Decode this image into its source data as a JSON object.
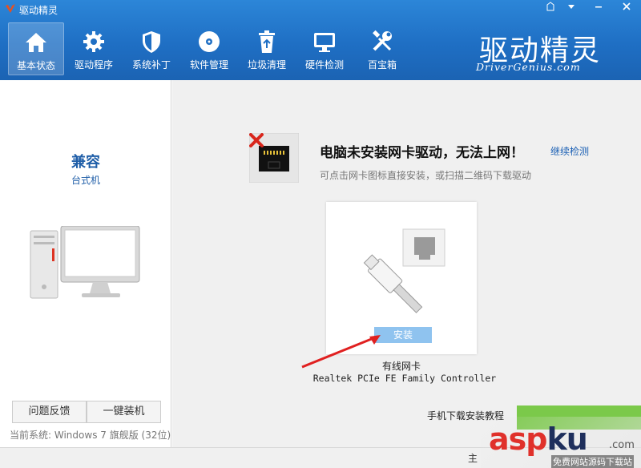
{
  "window": {
    "title": "驱动精灵",
    "controls": [
      "skin",
      "menu",
      "minimize",
      "close"
    ]
  },
  "nav": [
    {
      "label": "基本状态",
      "icon": "home-icon",
      "active": true
    },
    {
      "label": "驱动程序",
      "icon": "gear-icon",
      "active": false
    },
    {
      "label": "系统补丁",
      "icon": "shield-icon",
      "active": false
    },
    {
      "label": "软件管理",
      "icon": "disc-icon",
      "active": false
    },
    {
      "label": "垃圾清理",
      "icon": "recycle-bin-icon",
      "active": false
    },
    {
      "label": "硬件检测",
      "icon": "monitor-icon",
      "active": false
    },
    {
      "label": "百宝箱",
      "icon": "tools-icon",
      "active": false
    }
  ],
  "brand": {
    "cn": "驱动精灵",
    "url": "DriverGenius.com"
  },
  "left": {
    "title": "兼容",
    "subtitle": "台式机",
    "feedback_label": "问题反馈",
    "install_label": "一键装机",
    "system_prefix": "当前系统:",
    "system_value": "Windows 7 旗舰版 (32位)"
  },
  "main": {
    "alert_title": "电脑未安装网卡驱动，无法上网！",
    "recheck_label": "继续检测",
    "alert_desc": "可点击网卡图标直接安装，或扫描二维码下载驱动",
    "card_install_label": "安装",
    "device_name": "有线网卡",
    "device_model": "Realtek PCIe FE Family Controller",
    "mobile_tutorial": "手机下载安装教程"
  },
  "statusbar": {
    "main_label": "主"
  },
  "watermark": {
    "red": "asp",
    "dark": "ku",
    "dotcom": ".com",
    "sub": "免费网站源码下载站"
  },
  "colors": {
    "header_blue": "#2c86d8",
    "link_blue": "#1a5fb4",
    "install_button": "#8fc3ef",
    "accent_green": "#7bc94a",
    "error_red": "#e0312b"
  }
}
